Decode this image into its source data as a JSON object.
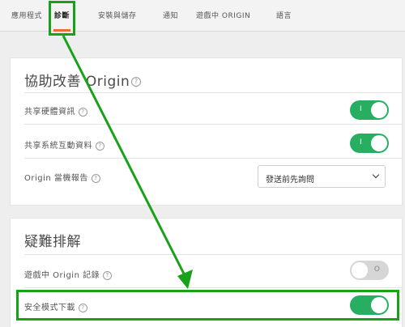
{
  "tabs": [
    {
      "label": "應用程式"
    },
    {
      "label": "診斷",
      "active": true
    },
    {
      "label": "安裝與儲存"
    },
    {
      "label": "通知"
    },
    {
      "label": "遊戲中 ORIGIN"
    },
    {
      "label": "語言"
    }
  ],
  "sections": {
    "improve": {
      "title": "協助改善 Origin",
      "rows": {
        "hardware": {
          "label": "共享硬體資訊",
          "toggle": "on",
          "toggle_text": "I"
        },
        "interaction": {
          "label": "共享系統互動資料",
          "toggle": "on",
          "toggle_text": "I"
        },
        "crash": {
          "label": "Origin 當機報告",
          "select_value": "發送前先詢問"
        }
      }
    },
    "troubleshoot": {
      "title": "疑難排解",
      "rows": {
        "ingame_log": {
          "label": "遊戲中 Origin 記錄",
          "toggle": "off",
          "toggle_text": "O"
        },
        "safe_mode": {
          "label": "安全模式下載",
          "toggle": "on"
        }
      }
    }
  },
  "help_glyph": "?",
  "colors": {
    "accent": "#f06b35",
    "toggle_on": "#27ae60",
    "annotation": "#1aa11a"
  }
}
